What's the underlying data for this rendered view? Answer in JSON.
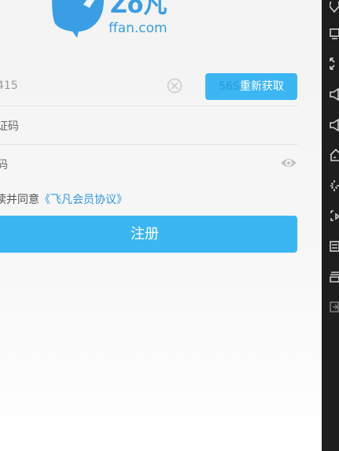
{
  "logo": {
    "brand_glyph": "Zo凡",
    "domain_text": "ffan.com",
    "brand_color": "#3a9ee4"
  },
  "form": {
    "phone_value": "415",
    "phone_clear_icon": "clear-circle-icon",
    "resend_countdown": "56S",
    "resend_label": "重新获取",
    "code_placeholder": "证码",
    "password_placeholder": "码",
    "password_visibility_icon": "eye-icon"
  },
  "agreement": {
    "prefix": "读并同意",
    "link": "《飞凡会员协议》"
  },
  "register": {
    "label": "注册"
  },
  "colors": {
    "accent": "#3cb6f3",
    "link": "#2f97e0",
    "toolbar_bg": "#1e1e1e"
  },
  "toolbar": {
    "items": [
      "location-icon",
      "screen-icon",
      "fullscreen-icon",
      "volume-down-icon",
      "volume-up-icon",
      "home-icon",
      "loading-icon",
      "screenshot-icon",
      "keyboard-icon",
      "layers-icon",
      "exit-icon"
    ]
  }
}
